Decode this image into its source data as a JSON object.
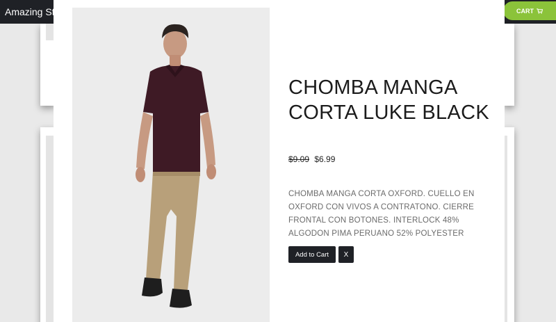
{
  "header": {
    "brand": "Amazing Sto",
    "cart_label": "CART",
    "cart_icon": "cart-icon"
  },
  "modal": {
    "title": "CHOMBA MANGA CORTA LUKE BLACK",
    "old_price": "$9.09",
    "price": "$6.99",
    "description": "CHOMBA MANGA CORTA OXFORD. CUELLO EN OXFORD CON VIVOS A CONTRATONO. CIERRE FRONTAL CON BOTONES. INTERLOCK 48% ALGODON PIMA PERUANO 52% POLYESTER",
    "add_to_cart_label": "Add to Cart",
    "close_label": "X",
    "image_alt": "Model wearing burgundy polo shirt and khaki pants"
  },
  "colors": {
    "navbar": "#1f2126",
    "accent": "#8bc33a",
    "button": "#1f2126",
    "text_dark": "#1b1b1b",
    "text_muted": "#6b6b6b"
  }
}
